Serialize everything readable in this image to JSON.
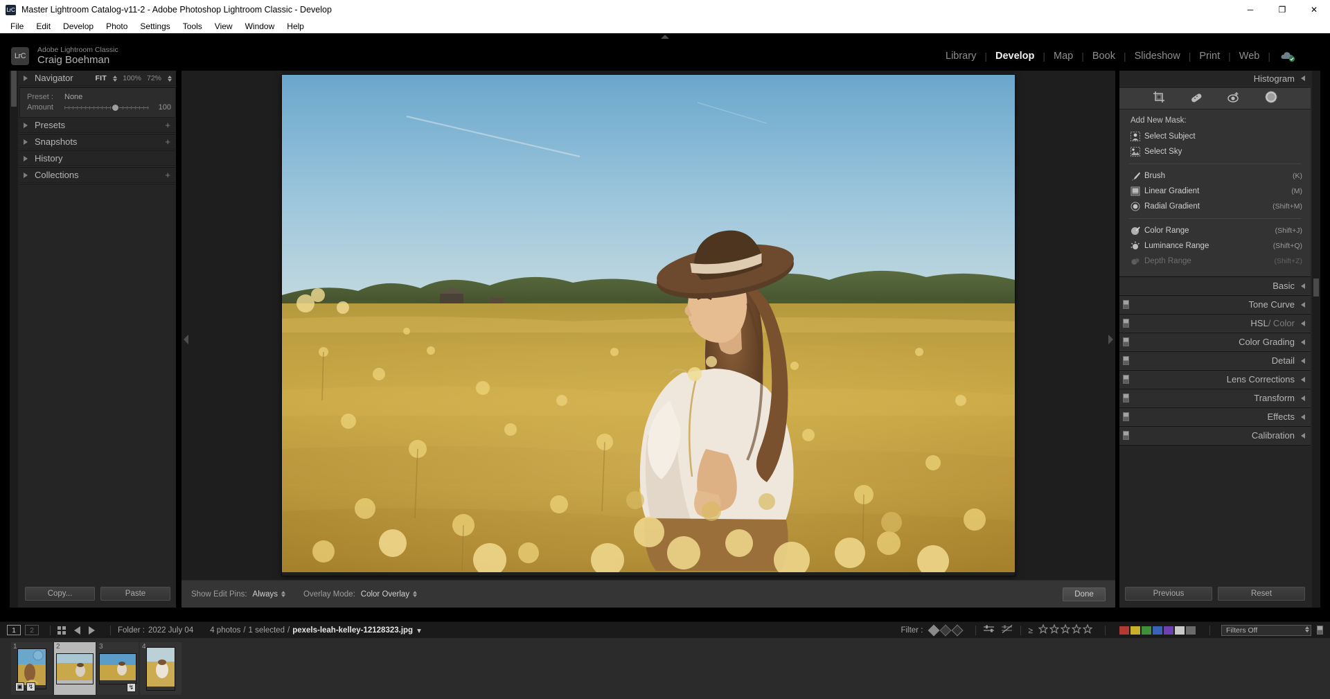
{
  "window": {
    "title": "Master Lightroom Catalog-v11-2 - Adobe Photoshop Lightroom Classic - Develop",
    "app_icon": "LrC",
    "minimize": "─",
    "maximize": "❐",
    "close": "✕"
  },
  "menubar": [
    "File",
    "Edit",
    "Develop",
    "Photo",
    "Settings",
    "Tools",
    "View",
    "Window",
    "Help"
  ],
  "identity": {
    "logo": "LrC",
    "product": "Adobe Lightroom Classic",
    "user": "Craig Boehman"
  },
  "modules": [
    {
      "label": "Library",
      "active": false
    },
    {
      "label": "Develop",
      "active": true
    },
    {
      "label": "Map",
      "active": false
    },
    {
      "label": "Book",
      "active": false
    },
    {
      "label": "Slideshow",
      "active": false
    },
    {
      "label": "Print",
      "active": false
    },
    {
      "label": "Web",
      "active": false
    }
  ],
  "left_panel": {
    "navigator": {
      "title": "Navigator",
      "fit": "FIT",
      "zoom_100": "100%",
      "zoom_current": "72%"
    },
    "preset": {
      "label": "Preset :",
      "value": "None",
      "amount_label": "Amount",
      "amount_value": "100"
    },
    "sections": [
      {
        "label": "Presets",
        "has_plus": true
      },
      {
        "label": "Snapshots",
        "has_plus": true
      },
      {
        "label": "History",
        "has_plus": false
      },
      {
        "label": "Collections",
        "has_plus": true
      }
    ],
    "copy_label": "Copy...",
    "paste_label": "Paste"
  },
  "right_panel": {
    "histogram_title": "Histogram",
    "mask_tools": [
      "crop-icon",
      "healing-icon",
      "redeye-icon",
      "masking-icon"
    ],
    "masking": {
      "title": "Add New Mask:",
      "items": [
        {
          "label": "Select Subject",
          "key": "",
          "icon": "subject-icon",
          "disabled": false
        },
        {
          "label": "Select Sky",
          "key": "",
          "icon": "sky-icon",
          "disabled": false
        },
        {
          "label": "Brush",
          "key": "(K)",
          "icon": "brush-icon",
          "disabled": false
        },
        {
          "label": "Linear Gradient",
          "key": "(M)",
          "icon": "linear-gradient-icon",
          "disabled": false
        },
        {
          "label": "Radial Gradient",
          "key": "(Shift+M)",
          "icon": "radial-gradient-icon",
          "disabled": false
        },
        {
          "label": "Color Range",
          "key": "(Shift+J)",
          "icon": "color-range-icon",
          "disabled": false
        },
        {
          "label": "Luminance Range",
          "key": "(Shift+Q)",
          "icon": "luminance-range-icon",
          "disabled": false
        },
        {
          "label": "Depth Range",
          "key": "(Shift+Z)",
          "icon": "depth-range-icon",
          "disabled": true
        }
      ]
    },
    "sections": [
      {
        "label": "Basic",
        "muted": "",
        "switch": false
      },
      {
        "label": "Tone Curve",
        "muted": "",
        "switch": true
      },
      {
        "label": "HSL",
        "muted": " / Color",
        "switch": true
      },
      {
        "label": "Color Grading",
        "muted": "",
        "switch": true
      },
      {
        "label": "Detail",
        "muted": "",
        "switch": true
      },
      {
        "label": "Lens Corrections",
        "muted": "",
        "switch": true
      },
      {
        "label": "Transform",
        "muted": "",
        "switch": true
      },
      {
        "label": "Effects",
        "muted": "",
        "switch": true
      },
      {
        "label": "Calibration",
        "muted": "",
        "switch": true
      }
    ],
    "previous_label": "Previous",
    "reset_label": "Reset"
  },
  "toolstrip": {
    "show_edit_pins_label": "Show Edit Pins:",
    "show_edit_pins_value": "Always",
    "overlay_mode_label": "Overlay Mode:",
    "overlay_mode_value": "Color Overlay",
    "done_label": "Done"
  },
  "filmbar": {
    "page_1": "1",
    "page_2": "2",
    "folder_label": "Folder :",
    "folder_value": "2022 July 04",
    "photo_count": "4 photos",
    "selected": "1 selected",
    "filename": "pexels-leah-kelley-12128323.jpg",
    "filter_label": "Filter :",
    "filters_value": "Filters Off",
    "color_chips": [
      "#b33a33",
      "#c9b02c",
      "#3f8f3a",
      "#3a63b8",
      "#6e41b0",
      "#c9c9c9",
      "#6a6a6a"
    ]
  },
  "filmstrip": {
    "thumbs": [
      {
        "num": "1",
        "selected": false,
        "orientation": "portrait",
        "badges": [
          "crop-badge",
          "develop-badge"
        ]
      },
      {
        "num": "2",
        "selected": true,
        "orientation": "landscape",
        "badges": []
      },
      {
        "num": "3",
        "selected": false,
        "orientation": "landscape",
        "badges": [
          "develop-badge"
        ]
      },
      {
        "num": "4",
        "selected": false,
        "orientation": "portrait",
        "badges": []
      }
    ]
  },
  "colors": {
    "panel_bg": "#252525",
    "canvas_bg": "#1e1e1e",
    "accent_text": "#f2f2f2"
  }
}
